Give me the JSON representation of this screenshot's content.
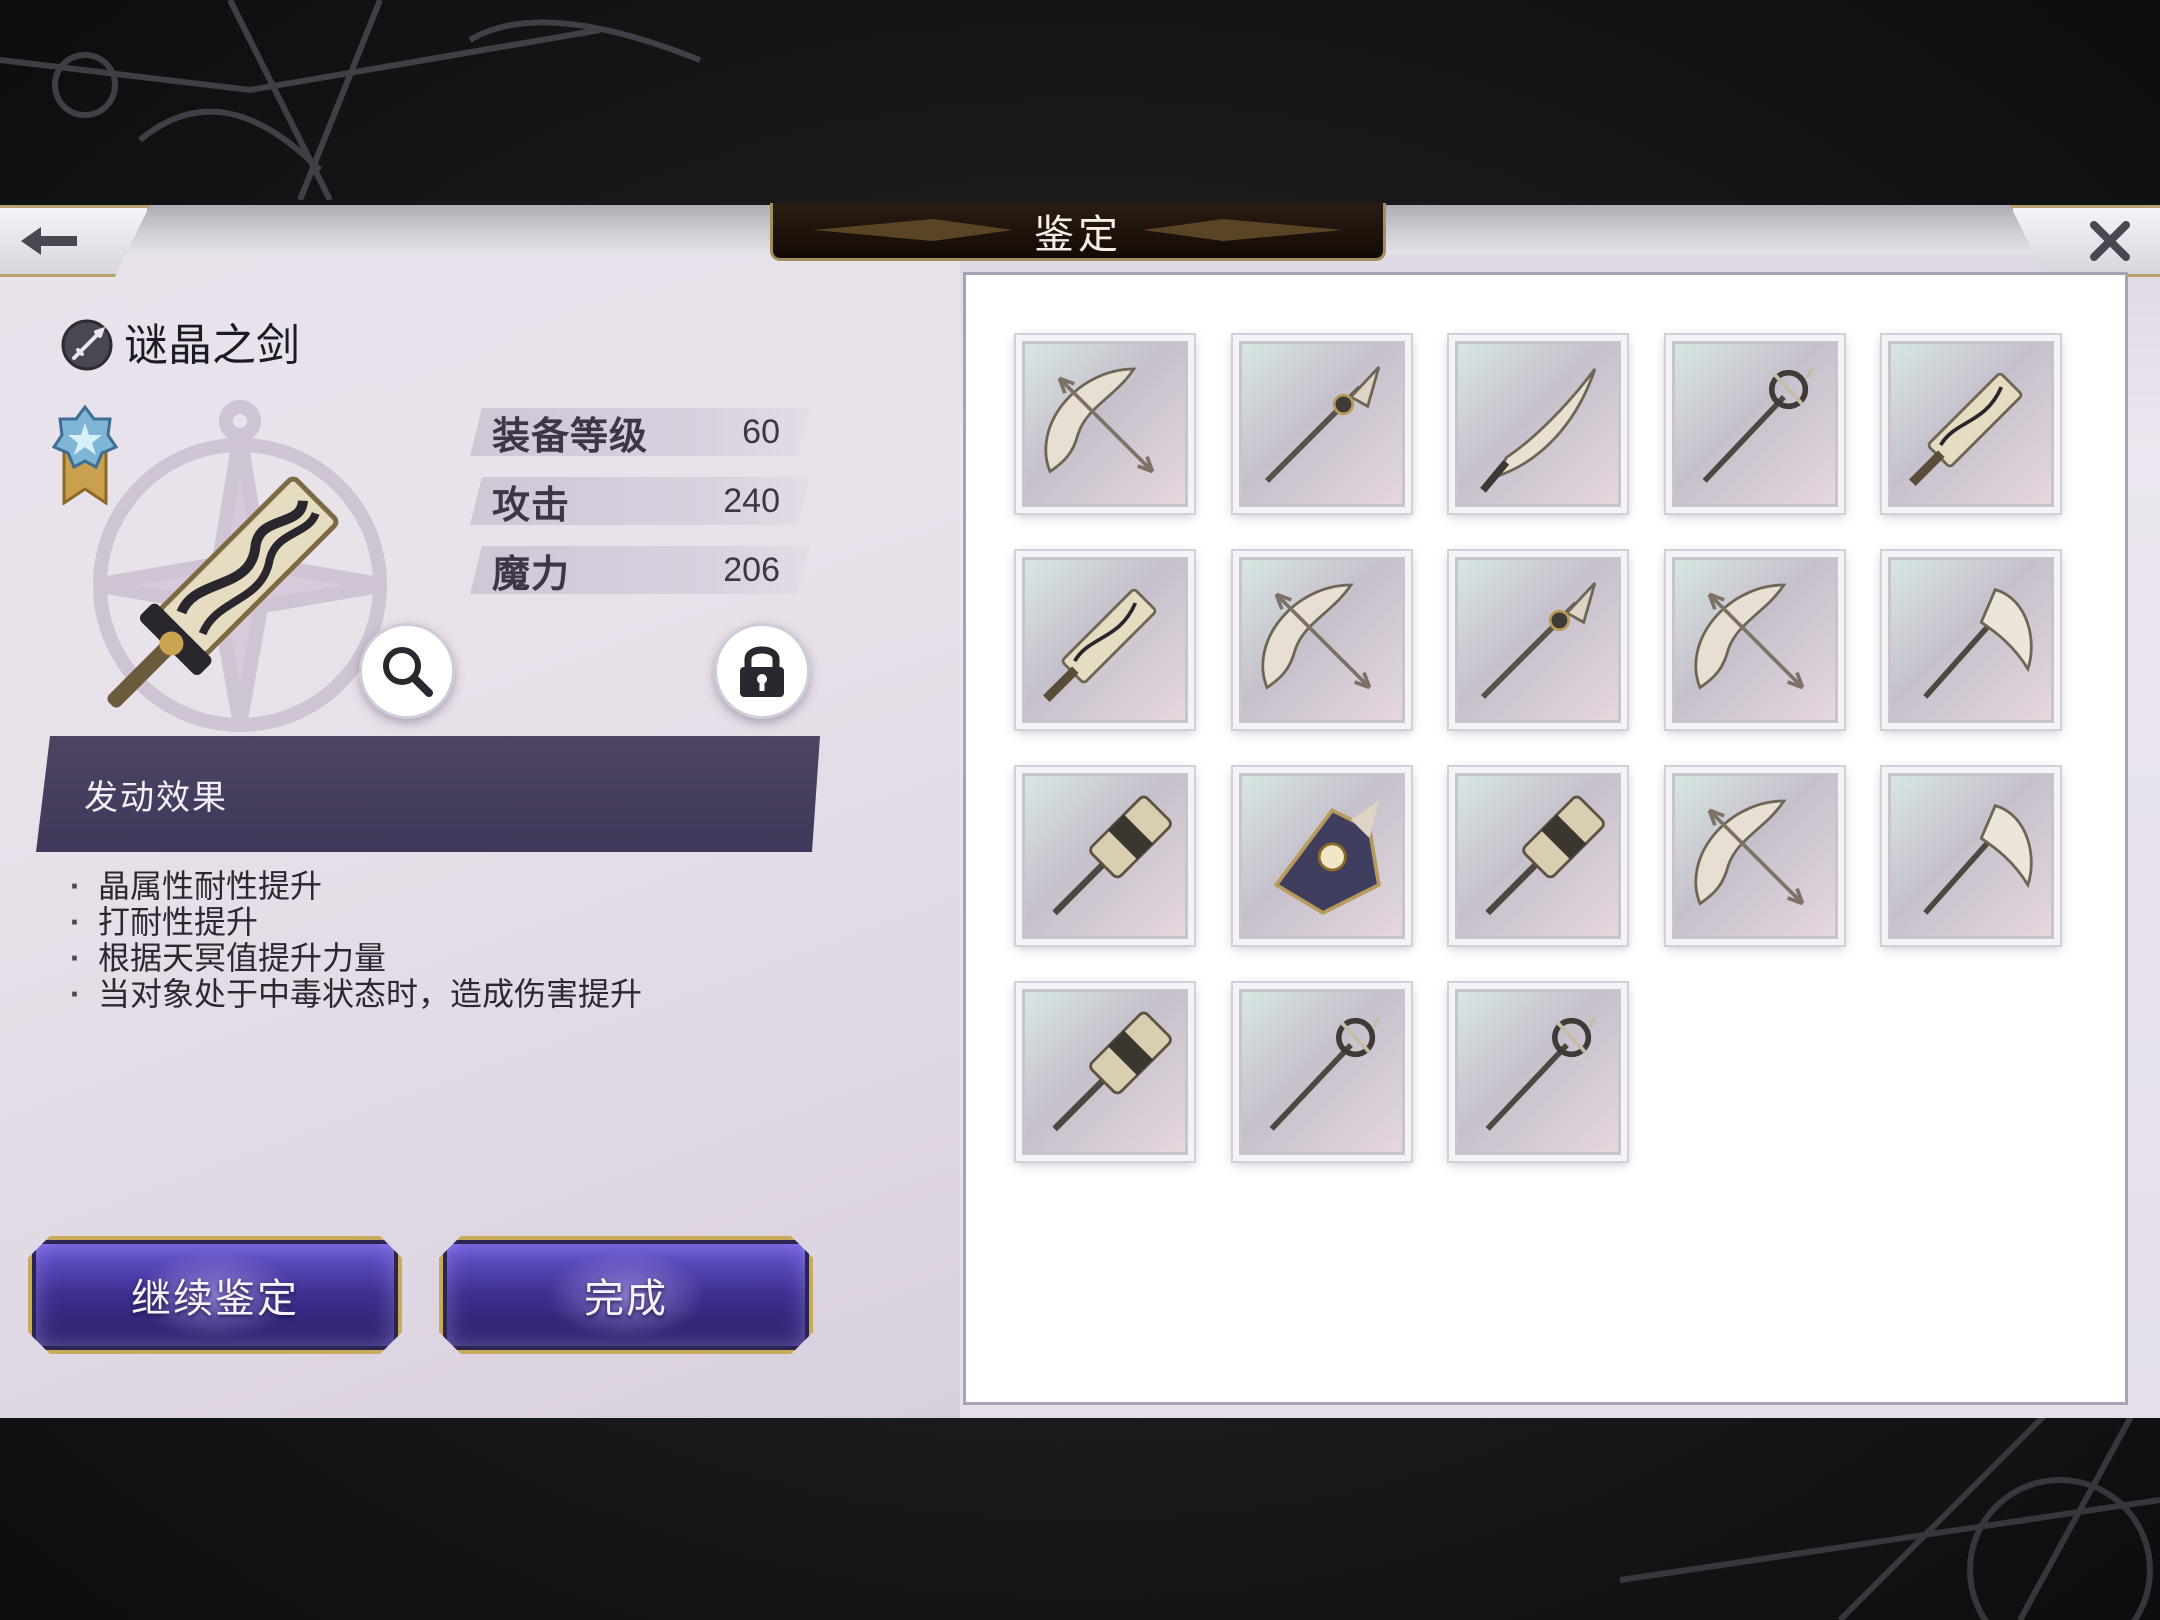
{
  "header": {
    "title": "鉴定"
  },
  "item": {
    "name": "谜晶之剑",
    "type_icon": "sword-icon",
    "stats": [
      {
        "label": "装备等级",
        "value": "60"
      },
      {
        "label": "攻击",
        "value": "240"
      },
      {
        "label": "魔力",
        "value": "206"
      }
    ]
  },
  "effect": {
    "title": "发动效果",
    "lines": [
      "晶属性耐性提升",
      "打耐性提升",
      "根据天冥值提升力量",
      "当对象处于中毒状态时，造成伤害提升"
    ]
  },
  "buttons": {
    "continue": "继续鉴定",
    "done": "完成"
  },
  "icons": {
    "back": "back-arrow-icon",
    "close": "close-icon",
    "zoom": "magnifier-icon",
    "lock": "lock-icon",
    "rank": "rank-badge-icon"
  },
  "grid": {
    "items": [
      {
        "weapon": "bow"
      },
      {
        "weapon": "spear"
      },
      {
        "weapon": "sword"
      },
      {
        "weapon": "staff"
      },
      {
        "weapon": "greatsword"
      },
      {
        "weapon": "greatsword"
      },
      {
        "weapon": "bow"
      },
      {
        "weapon": "spear"
      },
      {
        "weapon": "bow"
      },
      {
        "weapon": "axe"
      },
      {
        "weapon": "hammer"
      },
      {
        "weapon": "gauntlet"
      },
      {
        "weapon": "hammer"
      },
      {
        "weapon": "bow"
      },
      {
        "weapon": "axe"
      },
      {
        "weapon": "hammer"
      },
      {
        "weapon": "staff"
      },
      {
        "weapon": "staff"
      }
    ]
  },
  "colors": {
    "accent_gold": "#c9a95a",
    "button_purple": "#3c2f8e",
    "effect_header": "#4a4160"
  }
}
